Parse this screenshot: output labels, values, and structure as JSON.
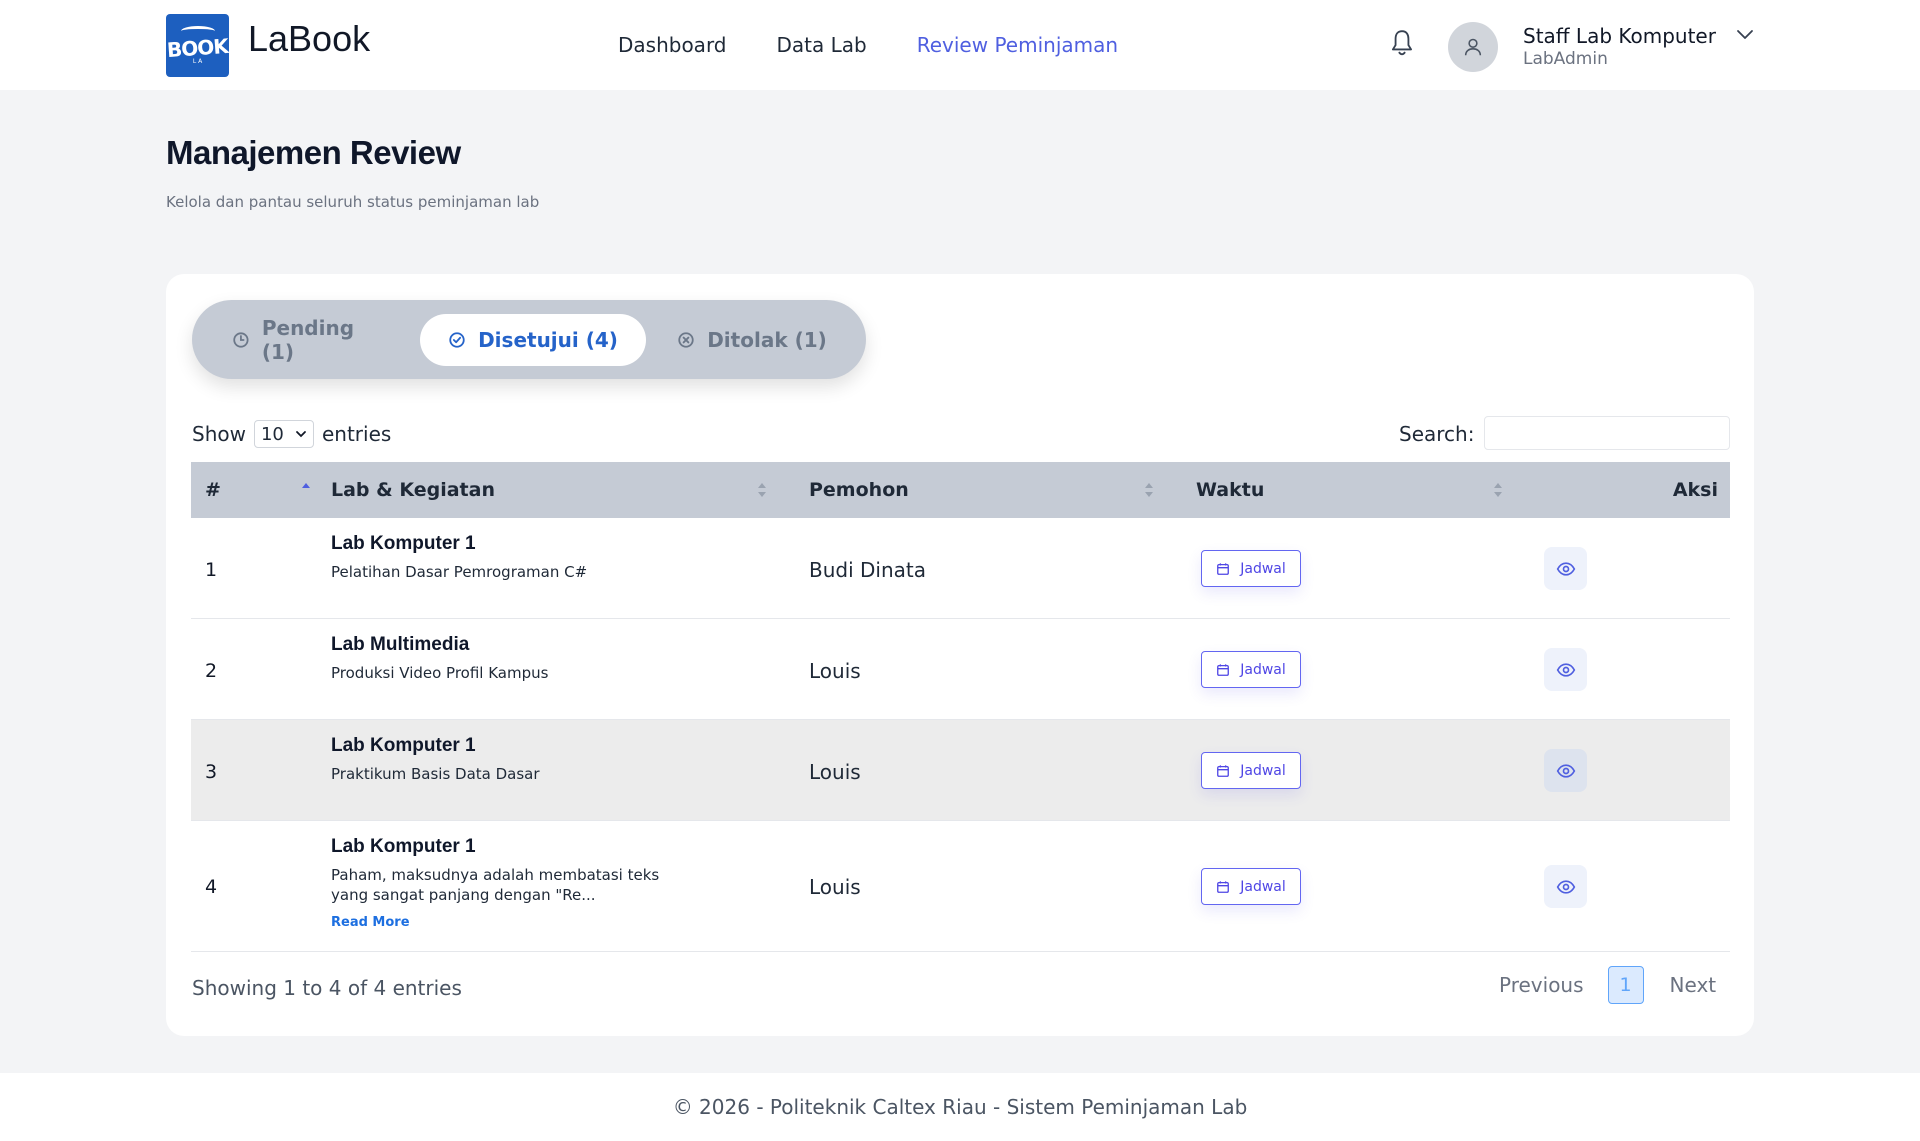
{
  "brand": {
    "logo_word": "BOOK",
    "logo_small": "L A",
    "name": "LaBook"
  },
  "nav": [
    {
      "label": "Dashboard",
      "active": false
    },
    {
      "label": "Data Lab",
      "active": false
    },
    {
      "label": "Review Peminjaman",
      "active": true
    }
  ],
  "user": {
    "name": "Staff Lab Komputer",
    "role": "LabAdmin"
  },
  "page": {
    "title": "Manajemen Review",
    "subtitle": "Kelola dan pantau seluruh status peminjaman lab"
  },
  "tabs": {
    "pending": "Pending (1)",
    "approved": "Disetujui (4)",
    "rejected": "Ditolak (1)"
  },
  "controls": {
    "show_label": "Show",
    "entries_value": "10",
    "entries_label": "entries",
    "search_label": "Search:",
    "search_value": ""
  },
  "table": {
    "headers": {
      "num": "#",
      "lab": "Lab & Kegiatan",
      "pemohon": "Pemohon",
      "waktu": "Waktu",
      "aksi": "Aksi"
    },
    "jadwal_label": "Jadwal",
    "read_more_label": "Read More",
    "rows": [
      {
        "num": "1",
        "lab": "Lab Komputer 1",
        "desc": "Pelatihan Dasar Pemrograman C#",
        "pemohon": "Budi Dinata"
      },
      {
        "num": "2",
        "lab": "Lab Multimedia",
        "desc": "Produksi Video Profil Kampus",
        "pemohon": "Louis"
      },
      {
        "num": "3",
        "lab": "Lab Komputer 1",
        "desc": "Praktikum Basis Data Dasar",
        "pemohon": "Louis"
      },
      {
        "num": "4",
        "lab": "Lab Komputer 1",
        "desc": "Paham, maksudnya adalah membatasi teks yang sangat panjang dengan \"Re...",
        "pemohon": "Louis"
      }
    ]
  },
  "pagination": {
    "info": "Showing 1 to 4 of 4 entries",
    "previous": "Previous",
    "current": "1",
    "next": "Next"
  },
  "footer": {
    "text": "© 2026 - Politeknik Caltex Riau - Sistem Peminjaman Lab"
  },
  "colors": {
    "accent": "#4f5fe0",
    "tab_active": "#2563c9",
    "header_row": "#c5cbd5",
    "logo_bg": "#1d5fbf"
  }
}
